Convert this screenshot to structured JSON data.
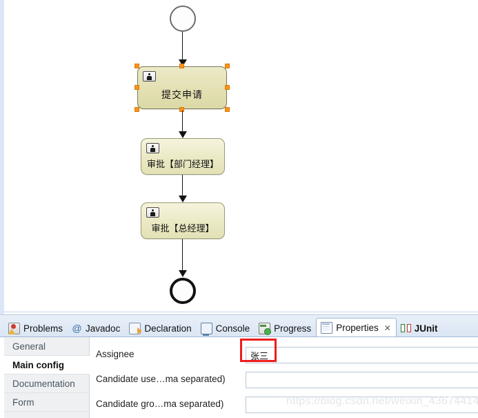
{
  "canvas": {
    "start_event": {
      "name": "start-event"
    },
    "end_event": {
      "name": "end-event"
    },
    "nodes": [
      {
        "label": "提交申请",
        "icon": "user-task-icon",
        "selected": true
      },
      {
        "label": "审批【部门经理】",
        "icon": "user-task-icon",
        "selected": false
      },
      {
        "label": "审批【总经理】",
        "icon": "user-task-icon",
        "selected": false
      }
    ]
  },
  "view_tabs": [
    {
      "label": "Problems",
      "icon": "problems-icon",
      "active": false,
      "bold": false,
      "closable": false
    },
    {
      "label": "Javadoc",
      "icon": "javadoc-at-icon",
      "active": false,
      "bold": false,
      "closable": false
    },
    {
      "label": "Declaration",
      "icon": "declaration-icon",
      "active": false,
      "bold": false,
      "closable": false
    },
    {
      "label": "Console",
      "icon": "console-icon",
      "active": false,
      "bold": false,
      "closable": false
    },
    {
      "label": "Progress",
      "icon": "progress-icon",
      "active": false,
      "bold": false,
      "closable": false
    },
    {
      "label": "Properties",
      "icon": "properties-icon",
      "active": true,
      "bold": false,
      "closable": true,
      "close_glyph": "✕"
    },
    {
      "label": "JUnit",
      "icon": "junit-icon",
      "active": false,
      "bold": true,
      "closable": false
    }
  ],
  "properties": {
    "sidebar": [
      {
        "label": "General",
        "active": false
      },
      {
        "label": "Main config",
        "active": true
      },
      {
        "label": "Documentation",
        "active": false
      },
      {
        "label": "Form",
        "active": false
      }
    ],
    "fields": [
      {
        "label": "Assignee",
        "value": "张三",
        "placeholder": ""
      },
      {
        "label": "Candidate use…ma separated)",
        "value": "",
        "placeholder": ""
      },
      {
        "label": "Candidate gro…ma separated)",
        "value": "",
        "placeholder": ""
      }
    ]
  },
  "annotation": {
    "highlight_color": "#ee1c1c"
  },
  "watermark": {
    "text": "https://blog.csdn.net/weixin_43674414"
  }
}
